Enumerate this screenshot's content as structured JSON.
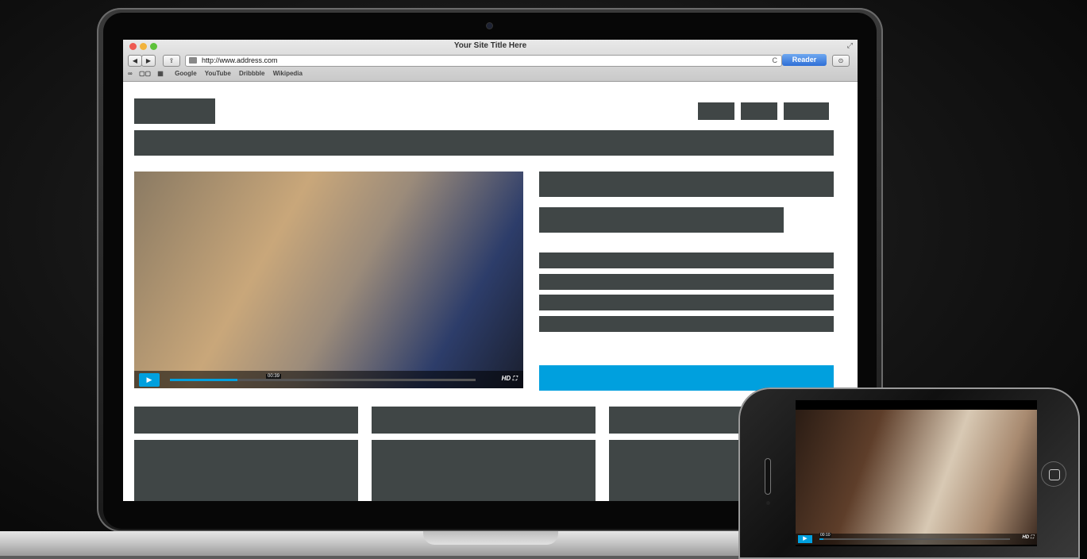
{
  "browser": {
    "title": "Your Site Title Here",
    "url": "http://www.address.com",
    "reader_label": "Reader",
    "bookmarks": [
      "Google",
      "YouTube",
      "Dribbble",
      "Wikipedia"
    ],
    "nav_back": "◀",
    "nav_forward": "▶",
    "share": "⇪",
    "reload": "C"
  },
  "video": {
    "play_icon": "▶",
    "time_label": "00:39",
    "hd_label": "HD ⛶",
    "progress": 0.22
  },
  "phone_video": {
    "play_icon": "▶",
    "time_label": "00:10",
    "hd_label": "HD ⛶",
    "progress": 0.02
  },
  "colors": {
    "block": "#404646",
    "accent": "#00a0de"
  }
}
